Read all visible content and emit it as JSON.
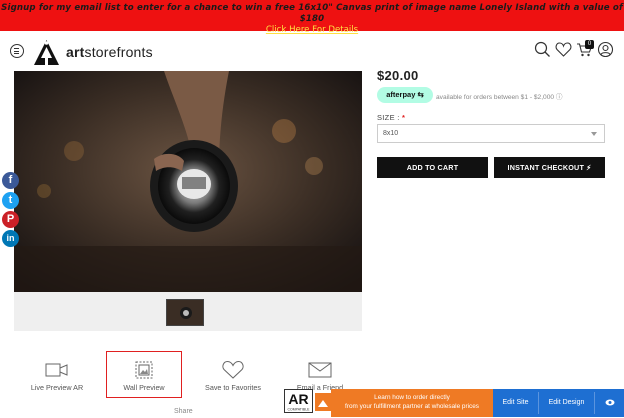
{
  "promo": {
    "message": "Signup for my email list to enter for a chance to win a free 16x10\" Canvas print of image name Lonely Island with a value of $180",
    "link": "Click Here For Details"
  },
  "header": {
    "logo_bold": "art",
    "logo_rest": "storefronts",
    "cart_count": "0"
  },
  "product": {
    "price": "$20.00",
    "afterpay_label": "afterpay",
    "afterpay_note": "available for orders between $1 - $2,000",
    "size_label": "SIZE :",
    "size_required": "*",
    "size_value": "8x10",
    "add_to_cart": "ADD TO CART",
    "instant_checkout": "INSTANT CHECKOUT"
  },
  "social": [
    {
      "name": "facebook",
      "glyph": "f",
      "color": "#3b5998"
    },
    {
      "name": "twitter",
      "glyph": "t",
      "color": "#1da1f2"
    },
    {
      "name": "pinterest",
      "glyph": "P",
      "color": "#cb2027"
    },
    {
      "name": "linkedin",
      "glyph": "in",
      "color": "#0077b5"
    }
  ],
  "actions": {
    "live_preview": "Live Preview AR",
    "wall_preview": "Wall Preview",
    "save_favorites": "Save to Favorites",
    "email_friend": "Email a Friend",
    "share": "Share"
  },
  "footer": {
    "ar_text": "AR",
    "ar_sub": "COMPATIBLE",
    "learn_line1": "Learn how to order directly",
    "learn_line2": "from your fulfillment partner at wholesale prices",
    "edit_site": "Edit Site",
    "edit_design": "Edit Design"
  },
  "icons": [
    "menu-icon",
    "logo-icon",
    "search-icon",
    "heart-icon",
    "cart-icon",
    "user-icon",
    "ar-camera-icon",
    "wall-preview-icon",
    "email-icon",
    "eye-icon"
  ]
}
